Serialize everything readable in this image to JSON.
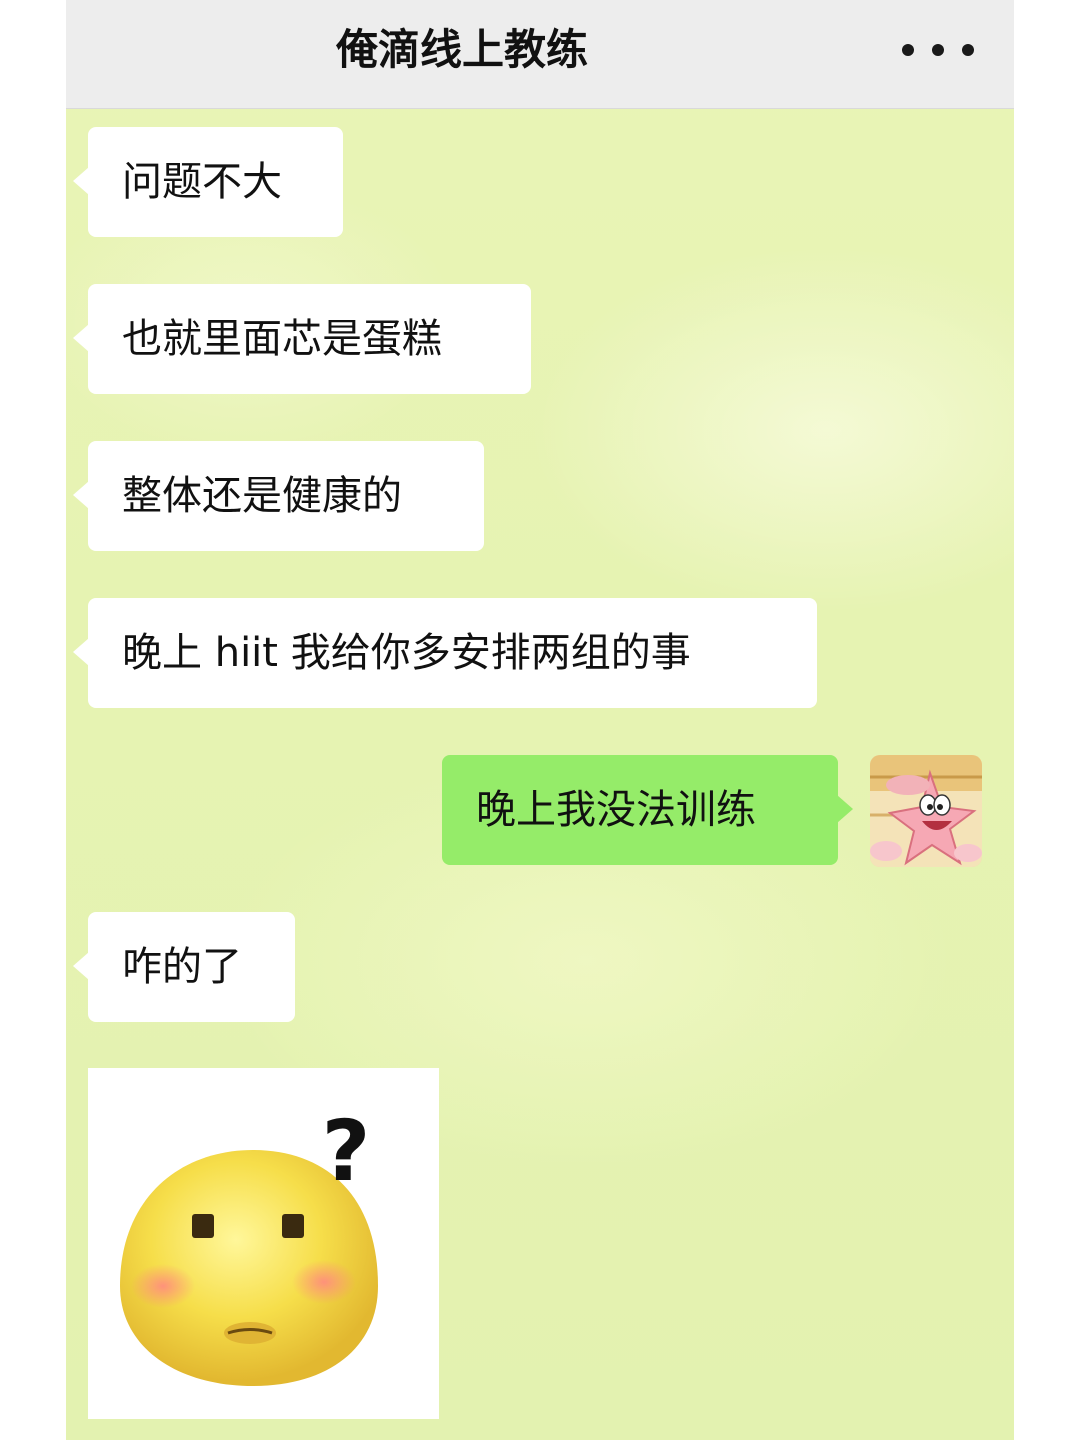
{
  "header": {
    "title": "俺滴线上教练",
    "more_icon": "more-horizontal-icon"
  },
  "messages": [
    {
      "direction": "incoming",
      "text": "问题不大"
    },
    {
      "direction": "incoming",
      "text": "也就里面芯是蛋糕"
    },
    {
      "direction": "incoming",
      "text": "整体还是健康的"
    },
    {
      "direction": "incoming",
      "text": "晚上 hiit  我给你多安排两组的事"
    },
    {
      "direction": "outgoing",
      "text": "晚上我没法训练",
      "avatar": "patrick-star-avatar"
    },
    {
      "direction": "incoming",
      "text": "咋的了"
    },
    {
      "direction": "incoming",
      "type": "sticker",
      "sticker": "confused-yellow-face-sticker",
      "sticker_text": "?"
    }
  ],
  "colors": {
    "chat_background": "#e6f3b2",
    "header_background": "#ededed",
    "incoming_bubble": "#ffffff",
    "outgoing_bubble": "#95ec69",
    "text": "#111111"
  }
}
